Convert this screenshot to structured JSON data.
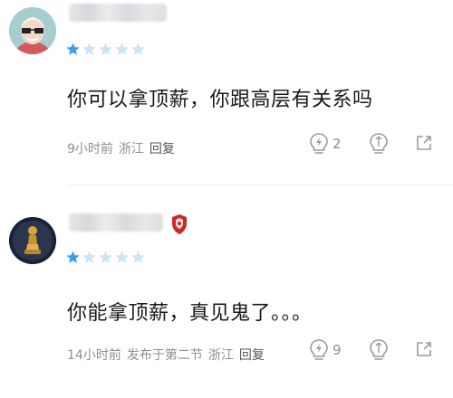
{
  "comments": [
    {
      "stars_filled": 1,
      "stars_total": 5,
      "text": "你可以拿顶薪，你跟高层有关系吗",
      "time": "9小时前",
      "section": "",
      "region": "浙江",
      "reply_label": "回复",
      "like_count": "2"
    },
    {
      "stars_filled": 1,
      "stars_total": 5,
      "text": "你能拿顶薪，真见鬼了。。。",
      "time": "14小时前",
      "section": "发布于第二节",
      "region": "浙江",
      "reply_label": "回复",
      "like_count": "9"
    }
  ],
  "colors": {
    "star_filled": "#3a9ef0",
    "star_empty": "#c9e4fb",
    "icon_gray": "#9a9a9a",
    "badge_red": "#cc2a2a"
  },
  "icons": [
    "avatar-elderly-glasses",
    "avatar-golden-trophy",
    "shield-badge-icon",
    "star-icon",
    "like-bulb-icon",
    "dislike-bulb-icon",
    "share-icon"
  ]
}
